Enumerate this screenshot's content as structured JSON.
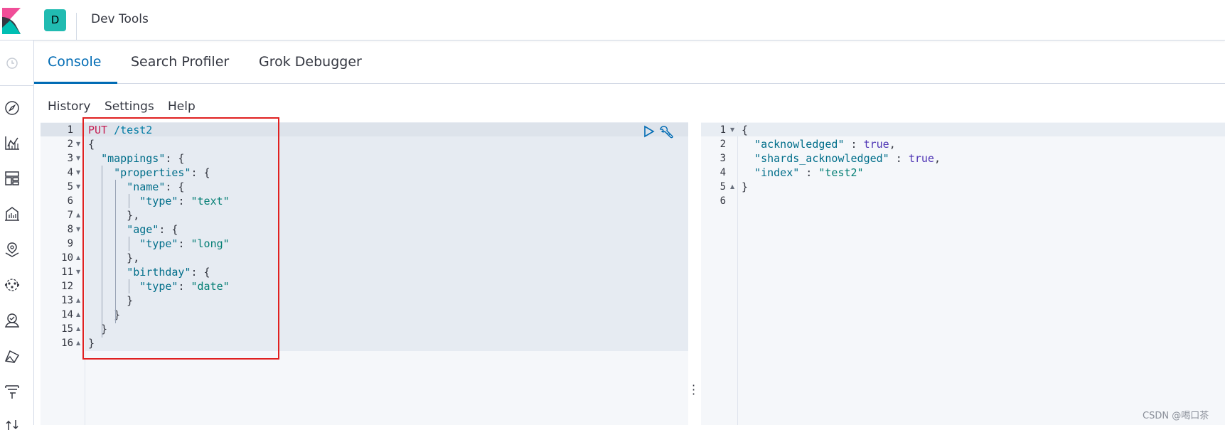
{
  "header": {
    "space_initial": "D",
    "app_title": "Dev Tools"
  },
  "nav": {
    "icons": [
      "clock-icon",
      "compass-icon",
      "visualize-icon",
      "dashboard-icon",
      "canvas-icon",
      "maps-icon",
      "ml-icon",
      "infrastructure-icon",
      "logs-icon",
      "apm-icon",
      "uptime-icon"
    ]
  },
  "tabs": [
    {
      "label": "Console",
      "active": true
    },
    {
      "label": "Search Profiler",
      "active": false
    },
    {
      "label": "Grok Debugger",
      "active": false
    }
  ],
  "menu": {
    "history": "History",
    "settings": "Settings",
    "help": "Help"
  },
  "request": {
    "lines": [
      {
        "n": "1",
        "fold": "",
        "tokens": [
          [
            "method",
            "PUT"
          ],
          [
            "url",
            " /test2"
          ]
        ]
      },
      {
        "n": "2",
        "fold": "▼",
        "tokens": [
          [
            "punc",
            "{"
          ]
        ]
      },
      {
        "n": "3",
        "fold": "▼",
        "tokens": [
          [
            "punc",
            "  "
          ],
          [
            "key",
            "\"mappings\""
          ],
          [
            "punc",
            ": {"
          ]
        ]
      },
      {
        "n": "4",
        "fold": "▼",
        "tokens": [
          [
            "punc",
            "    "
          ],
          [
            "key",
            "\"properties\""
          ],
          [
            "punc",
            ": {"
          ]
        ]
      },
      {
        "n": "5",
        "fold": "▼",
        "tokens": [
          [
            "punc",
            "      "
          ],
          [
            "key",
            "\"name\""
          ],
          [
            "punc",
            ": {"
          ]
        ]
      },
      {
        "n": "6",
        "fold": "",
        "tokens": [
          [
            "punc",
            "        "
          ],
          [
            "key",
            "\"type\""
          ],
          [
            "punc",
            ": "
          ],
          [
            "str",
            "\"text\""
          ]
        ]
      },
      {
        "n": "7",
        "fold": "▲",
        "tokens": [
          [
            "punc",
            "      },"
          ]
        ]
      },
      {
        "n": "8",
        "fold": "▼",
        "tokens": [
          [
            "punc",
            "      "
          ],
          [
            "key",
            "\"age\""
          ],
          [
            "punc",
            ": {"
          ]
        ]
      },
      {
        "n": "9",
        "fold": "",
        "tokens": [
          [
            "punc",
            "        "
          ],
          [
            "key",
            "\"type\""
          ],
          [
            "punc",
            ": "
          ],
          [
            "str",
            "\"long\""
          ]
        ]
      },
      {
        "n": "10",
        "fold": "▲",
        "tokens": [
          [
            "punc",
            "      },"
          ]
        ]
      },
      {
        "n": "11",
        "fold": "▼",
        "tokens": [
          [
            "punc",
            "      "
          ],
          [
            "key",
            "\"birthday\""
          ],
          [
            "punc",
            ": {"
          ]
        ]
      },
      {
        "n": "12",
        "fold": "",
        "tokens": [
          [
            "punc",
            "        "
          ],
          [
            "key",
            "\"type\""
          ],
          [
            "punc",
            ": "
          ],
          [
            "str",
            "\"date\""
          ]
        ]
      },
      {
        "n": "13",
        "fold": "▲",
        "tokens": [
          [
            "punc",
            "      }"
          ]
        ]
      },
      {
        "n": "14",
        "fold": "▲",
        "tokens": [
          [
            "punc",
            "    }"
          ]
        ]
      },
      {
        "n": "15",
        "fold": "▲",
        "tokens": [
          [
            "punc",
            "  }"
          ]
        ]
      },
      {
        "n": "16",
        "fold": "▲",
        "tokens": [
          [
            "punc",
            "}"
          ]
        ]
      }
    ]
  },
  "response": {
    "lines": [
      {
        "n": "1",
        "fold": "▼",
        "tokens": [
          [
            "punc",
            "{"
          ]
        ]
      },
      {
        "n": "2",
        "fold": "",
        "tokens": [
          [
            "punc",
            "  "
          ],
          [
            "key",
            "\"acknowledged\""
          ],
          [
            "punc",
            " : "
          ],
          [
            "bool",
            "true"
          ],
          [
            "punc",
            ","
          ]
        ]
      },
      {
        "n": "3",
        "fold": "",
        "tokens": [
          [
            "punc",
            "  "
          ],
          [
            "key",
            "\"shards_acknowledged\""
          ],
          [
            "punc",
            " : "
          ],
          [
            "bool",
            "true"
          ],
          [
            "punc",
            ","
          ]
        ]
      },
      {
        "n": "4",
        "fold": "",
        "tokens": [
          [
            "punc",
            "  "
          ],
          [
            "key",
            "\"index\""
          ],
          [
            "punc",
            " : "
          ],
          [
            "str",
            "\"test2\""
          ]
        ]
      },
      {
        "n": "5",
        "fold": "▲",
        "tokens": [
          [
            "punc",
            "}"
          ]
        ]
      },
      {
        "n": "6",
        "fold": "",
        "tokens": []
      }
    ]
  },
  "watermark": "CSDN @喝口茶",
  "colors": {
    "accent": "#006bb4",
    "space_badge": "#21bbb1",
    "highlight_box": "#e02020"
  }
}
